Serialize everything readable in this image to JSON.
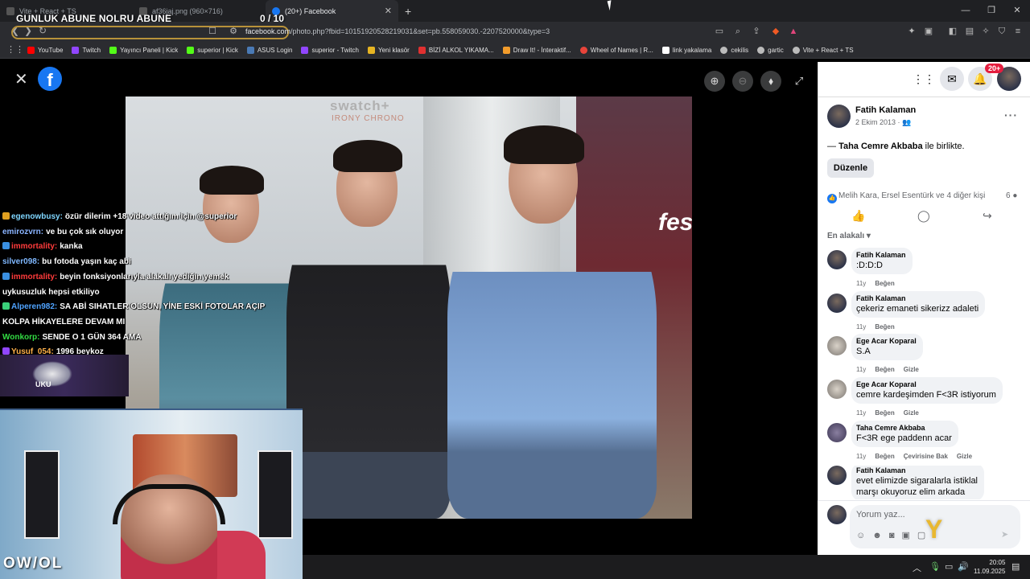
{
  "overlay": {
    "title": "GUNLUK ABUNE NOLRU ABUNE",
    "count": "0  / 10"
  },
  "browser": {
    "tabs": [
      {
        "label": "Vite + React + TS"
      },
      {
        "label": "af36jaj.png (960×716)"
      },
      {
        "label": "(20+) Facebook"
      }
    ],
    "new_tab": "+",
    "url_host": "facebook.com",
    "url_path": "/photo.php?fbid=10151920528219031&set=pb.558059030.-2207520000&type=3",
    "bookmarks": [
      {
        "label": "YouTube",
        "color": "#ff0000"
      },
      {
        "label": "Twitch",
        "color": "#9146ff"
      },
      {
        "label": "Yayıncı Paneli | Kick",
        "color": "#53fc18"
      },
      {
        "label": "superior | Kick",
        "color": "#53fc18"
      },
      {
        "label": "ASUS Login",
        "color": "#4a7ab5"
      },
      {
        "label": "superior - Twitch",
        "color": "#9146ff"
      },
      {
        "label": "Yeni klasör",
        "color": "#e6b422"
      },
      {
        "label": "BİZİ ALKOL YIKAMA...",
        "color": "#e03030"
      },
      {
        "label": "Draw It! - İnteraktif...",
        "color": "#f29c2b"
      },
      {
        "label": "Wheel of Names | R...",
        "color": "#e8443a"
      },
      {
        "label": "link yakalama",
        "color": "#ffffff"
      },
      {
        "label": "cekilis",
        "color": "#bbbbbb"
      },
      {
        "label": "gartic",
        "color": "#bbbbbb"
      },
      {
        "label": "Vite + React + TS",
        "color": "#bbbbbb"
      }
    ]
  },
  "photo": {
    "sign": "swatch+",
    "sign_sub": "IRONY CHRONO",
    "poster_text": "fest"
  },
  "chat": [
    {
      "user": "egenowbusy:",
      "color": "#7fd6ff",
      "msg": "özür dilerim +18 video attığım için @superior",
      "badge": "#e0a020"
    },
    {
      "user": "emirozvrn:",
      "color": "#8ab4ff",
      "msg": "ve bu çok sık oluyor",
      "badge": ""
    },
    {
      "user": "immortality:",
      "color": "#ff3b3b",
      "msg": "kanka",
      "badge": "#3a8fe0"
    },
    {
      "user": "silver098:",
      "color": "#7fb8ff",
      "msg": "bu fotoda yaşın kaç abi",
      "badge": ""
    },
    {
      "user": "immortality:",
      "color": "#ff3b3b",
      "msg": "beyin fonksiyonlarıyla alakalı yediğin yemek",
      "badge": "#3a8fe0"
    },
    {
      "user": "",
      "color": "#ffffff",
      "msg": "uykusuzluk hepsi etkiliyo",
      "badge": ""
    },
    {
      "user": "Alperen982:",
      "color": "#4fa3ff",
      "msg": "SA ABİ SIHATLER OLSUN, YİNE ESKİ FOTOLAR AÇIP",
      "badge": "#3ad07a"
    },
    {
      "user": "",
      "color": "#ffffff",
      "msg": "KOLPA HİKAYELERE DEVAM MI",
      "badge": ""
    },
    {
      "user": "Wonkorp:",
      "color": "#33dd44",
      "msg": "SENDE O 1 GÜN 364 AMA",
      "badge": ""
    },
    {
      "user": "Yusuf_054:",
      "color": "#ffb14a",
      "msg": "1996 beykoz",
      "badge": "#9146ff"
    }
  ],
  "emote_text": "UKU",
  "cam_logo": "OW/OL",
  "post": {
    "author": "Fatih Kalaman",
    "date": "2 Ekim 2013 · ",
    "with_prefix": "— ",
    "with_name": "Taha Cemre Akbaba",
    "with_suffix": " ile birlikte.",
    "edit_label": "Düzenle",
    "reactions": "Melih Kara, Ersel Esentürk ve 4 diğer kişi",
    "comment_count": "6",
    "sort_label": "En alakalı"
  },
  "notif_count": "20+",
  "comments": [
    {
      "name": "Fatih Kalaman",
      "text": ":D:D:D",
      "age": "11y",
      "actions": [
        "Beğen"
      ]
    },
    {
      "name": "Fatih Kalaman",
      "text": "çekeriz emaneti sikerizz adaleti",
      "age": "11y",
      "actions": [
        "Beğen"
      ]
    },
    {
      "name": "Ege Acar Koparal",
      "text": "S.A",
      "age": "11y",
      "actions": [
        "Beğen",
        "Gizle"
      ]
    },
    {
      "name": "Ege Acar Koparal",
      "text": "cemre kardeşimden F<3R istiyorum",
      "age": "11y",
      "actions": [
        "Beğen",
        "Gizle"
      ]
    },
    {
      "name": "Taha Cemre Akbaba",
      "text": "F<3R ege paddenn acar",
      "age": "11y",
      "actions": [
        "Beğen",
        "Çevirisine Bak",
        "Gizle"
      ]
    },
    {
      "name": "Fatih Kalaman",
      "text": "evet elimizde sigaralarla istiklal",
      "text2": "marşı okuyoruz elim arkada",
      "age": "",
      "actions": []
    }
  ],
  "composer_placeholder": "Yorum yaz...",
  "clock": {
    "time": "20:05",
    "date": "11.09.2025"
  }
}
